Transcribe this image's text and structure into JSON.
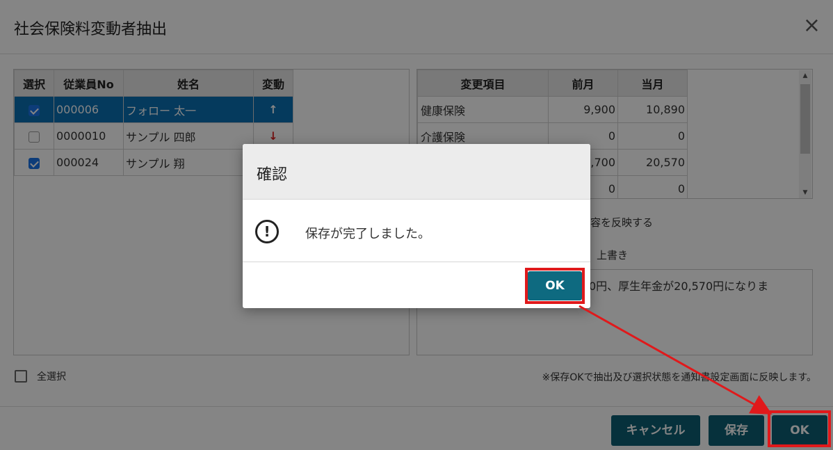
{
  "window": {
    "title": "社会保険料変動者抽出",
    "close_icon": "×"
  },
  "employee_table": {
    "headers": [
      "選択",
      "従業員No",
      "姓名",
      "変動"
    ],
    "rows": [
      {
        "checked": true,
        "no": "000006",
        "name": "フォロー 太一",
        "change": "↑",
        "selected": true
      },
      {
        "checked": false,
        "no": "0000010",
        "name": "サンプル 四郎",
        "change": "↓",
        "selected": false
      },
      {
        "checked": true,
        "no": "000024",
        "name": "サンプル 翔",
        "change": "",
        "selected": false
      }
    ]
  },
  "change_table": {
    "headers": [
      "変更項目",
      "前月",
      "当月"
    ],
    "rows": [
      {
        "item": "健康保険",
        "prev": "9,900",
        "curr": "10,890"
      },
      {
        "item": "介護保険",
        "prev": "0",
        "curr": "0"
      },
      {
        "item": "",
        "prev": "8,700",
        "curr": "20,570"
      },
      {
        "item": "",
        "prev": "0",
        "curr": "0"
      }
    ]
  },
  "options": {
    "reflect_label": "容を反映する",
    "overwrite_label": "上書き"
  },
  "memo": {
    "text": "0円、厚生年金が20,570円になりま"
  },
  "select_all": {
    "label": "全選択"
  },
  "note": "※保存OKで抽出及び選択状態を通知書設定画面に反映します。",
  "footer": {
    "cancel_label": "キャンセル",
    "save_label": "保存",
    "ok_label": "OK"
  },
  "dialog": {
    "title": "確認",
    "icon": "!",
    "message": "保存が完了しました。",
    "ok_label": "OK"
  },
  "colors": {
    "button_teal": "#0d5f73",
    "selected_row": "#0a6fb3",
    "highlight_red": "#e0191b"
  }
}
